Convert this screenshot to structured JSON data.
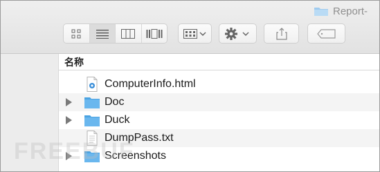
{
  "window": {
    "title": "Report-"
  },
  "toolbar": {
    "view_buttons": [
      {
        "name": "icon-view-button",
        "icon": "grid-icon",
        "active": false
      },
      {
        "name": "list-view-button",
        "icon": "list-icon",
        "active": true
      },
      {
        "name": "column-view-button",
        "icon": "columns-icon",
        "active": false
      },
      {
        "name": "gallery-view-button",
        "icon": "coverflow-icon",
        "active": false
      }
    ],
    "arrange_icon": "arrange-icon",
    "action_icon": "gear-icon",
    "share_icon": "share-icon",
    "tag_icon": "tag-icon"
  },
  "list": {
    "column_header": "名称",
    "rows": [
      {
        "name": "ComputerInfo.html",
        "kind": "html",
        "expandable": false
      },
      {
        "name": "Doc",
        "kind": "folder",
        "expandable": true
      },
      {
        "name": "Duck",
        "kind": "folder",
        "expandable": true
      },
      {
        "name": "DumpPass.txt",
        "kind": "text",
        "expandable": false
      },
      {
        "name": "Screenshots",
        "kind": "folder",
        "expandable": true
      }
    ]
  },
  "watermark": "FREEBUF",
  "colors": {
    "folder": "#6ab7ee",
    "folder_dark": "#4aa3e2",
    "accent": "#3b8fd9"
  }
}
